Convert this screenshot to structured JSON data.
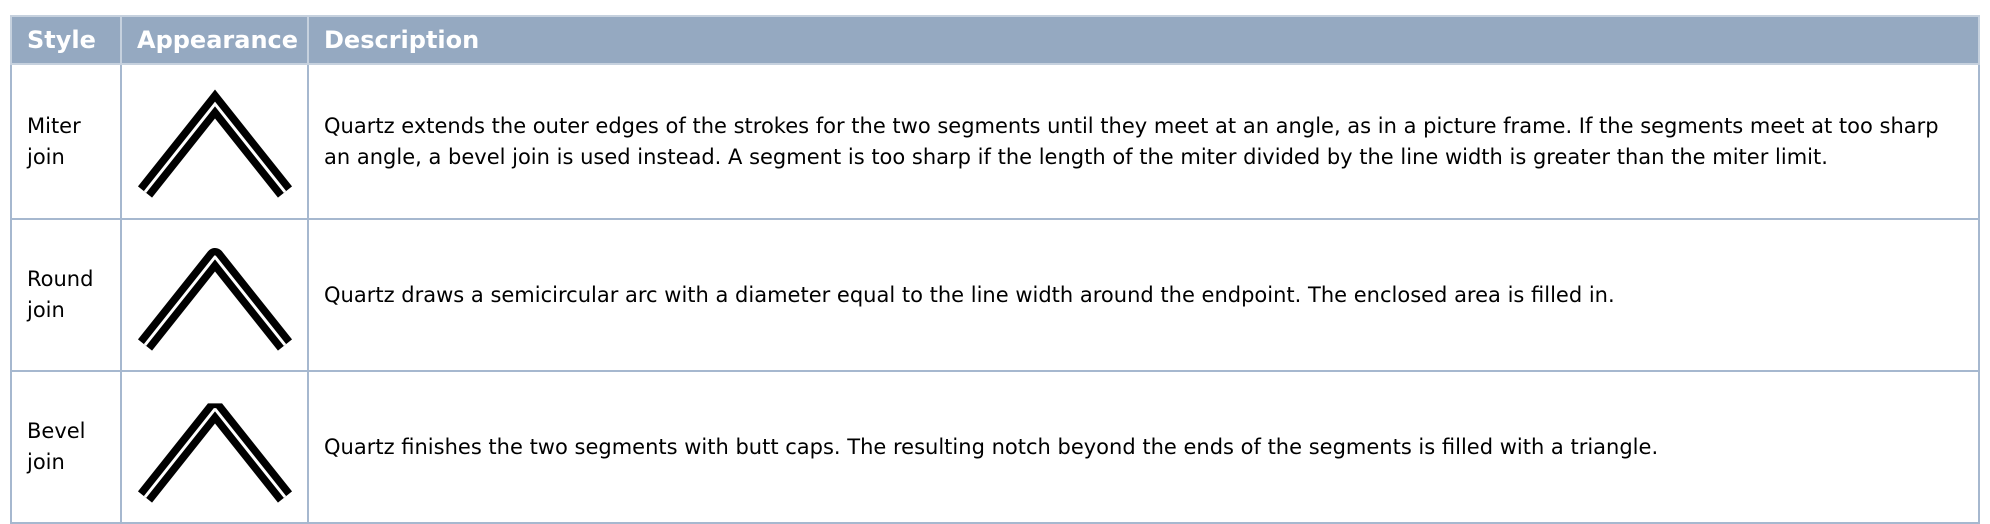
{
  "table": {
    "headers": {
      "style": "Style",
      "appearance": "Appearance",
      "description": "Description"
    },
    "rows": [
      {
        "style": "Miter join",
        "join": "miter",
        "description": "Quartz extends the outer edges of the strokes for the two segments until they meet at an angle, as in a picture frame. If the segments meet at too sharp an angle, a bevel join is used instead. A segment is too sharp if the length of the miter divided by the line width is greater than the miter limit."
      },
      {
        "style": "Round join",
        "join": "round",
        "description": "Quartz draws a semicircular arc with a diameter equal to the line width around the endpoint. The enclosed area is filled in."
      },
      {
        "style": "Bevel join",
        "join": "bevel",
        "description": "Quartz finishes the two segments with butt caps. The resulting notch beyond the ends of the segments is filled with a triangle."
      }
    ]
  },
  "colors": {
    "header_bg": "#95a9c1",
    "header_text": "#ffffff",
    "border": "#a6b8cf",
    "stroke_outer": "#000000",
    "stroke_inner": "#ffffff"
  }
}
